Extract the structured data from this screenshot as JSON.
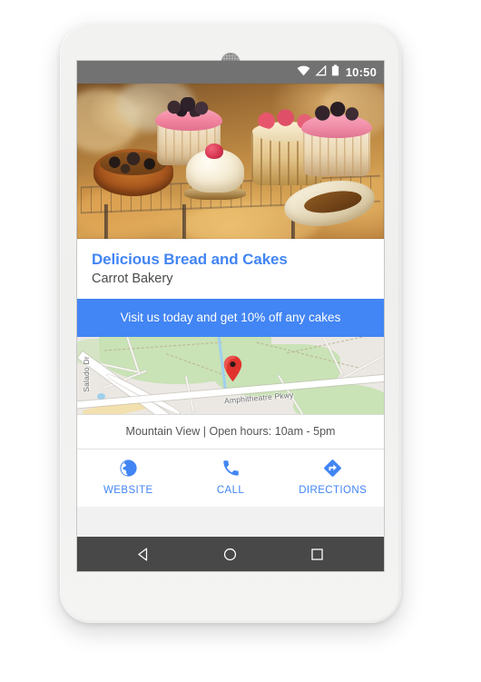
{
  "device": {
    "type": "android-phone",
    "frame_color": "#f1f1f0"
  },
  "status_bar": {
    "time": "10:50",
    "icons": [
      "wifi-icon",
      "cell-signal-icon",
      "battery-icon"
    ],
    "background": "#727272"
  },
  "hero": {
    "alt": "bakery-pastries-photo"
  },
  "card": {
    "title": "Delicious Bread and Cakes",
    "subtitle": "Carrot Bakery",
    "title_color": "#4285F4",
    "promo": {
      "text": "Visit us today and get 10% off any cakes",
      "background": "#4285F4",
      "text_color": "#ffffff"
    },
    "address_line": "Mountain View | Open hours: 10am - 5pm",
    "actions": [
      {
        "label": "WEBSITE",
        "icon": "globe-icon"
      },
      {
        "label": "CALL",
        "icon": "phone-icon"
      },
      {
        "label": "DIRECTIONS",
        "icon": "directions-icon"
      }
    ],
    "action_color": "#4285F4"
  },
  "map": {
    "labels": [
      {
        "name": "Salado Dr",
        "orientation": "vertical"
      },
      {
        "name": "Amphitheatre Pkwy",
        "orientation": "horizontal"
      }
    ],
    "marker": "map-pin-icon",
    "marker_color": "#e0332e"
  },
  "nav_bar": {
    "background": "#484848",
    "buttons": [
      {
        "name": "back",
        "icon": "triangle-back-icon"
      },
      {
        "name": "home",
        "icon": "circle-home-icon"
      },
      {
        "name": "recents",
        "icon": "square-recents-icon"
      }
    ]
  }
}
